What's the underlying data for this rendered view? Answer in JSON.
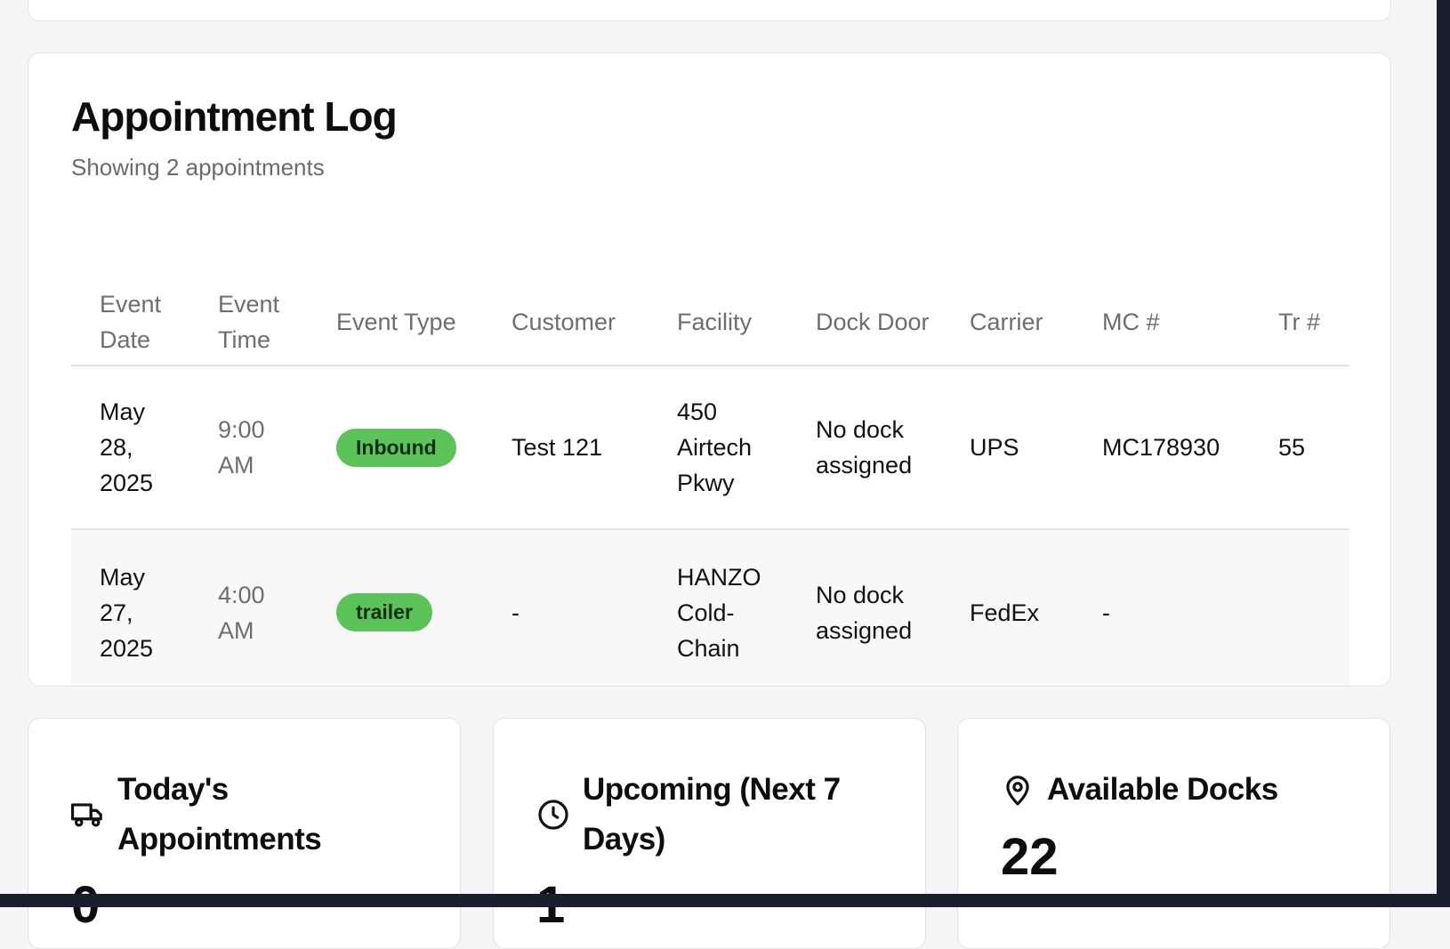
{
  "appointment_log": {
    "title": "Appointment Log",
    "subtitle": "Showing 2 appointments",
    "columns": [
      "Event Date",
      "Event Time",
      "Event Type",
      "Customer",
      "Facility",
      "Dock Door",
      "Carrier",
      "MC #",
      "Tr #"
    ],
    "rows": [
      {
        "event_date": "May 28, 2025",
        "event_time": "9:00 AM",
        "event_type": "Inbound",
        "customer": "Test 121",
        "facility": "450 Airtech Pkwy",
        "dock_door": "No dock assigned",
        "carrier": "UPS",
        "mc_number": "MC178930",
        "tr_number": "55"
      },
      {
        "event_date": "May 27, 2025",
        "event_time": "4:00 AM",
        "event_type": "trailer",
        "customer": "-",
        "facility": "HANZO Cold-Chain",
        "dock_door": "No dock assigned",
        "carrier": "FedEx",
        "mc_number": "-",
        "tr_number": ""
      }
    ]
  },
  "stats": [
    {
      "title": "Today's Appointments",
      "icon": "truck-icon",
      "value": "0"
    },
    {
      "title": "Upcoming (Next 7 Days)",
      "icon": "clock-icon",
      "value": "1"
    },
    {
      "title": "Available Docks",
      "icon": "map-pin-icon",
      "value": "22"
    }
  ],
  "colors": {
    "badge_green": "#5cc35a",
    "page_background": "#f5f5f5",
    "card_background": "#ffffff",
    "muted_text": "#6e6e6e"
  }
}
